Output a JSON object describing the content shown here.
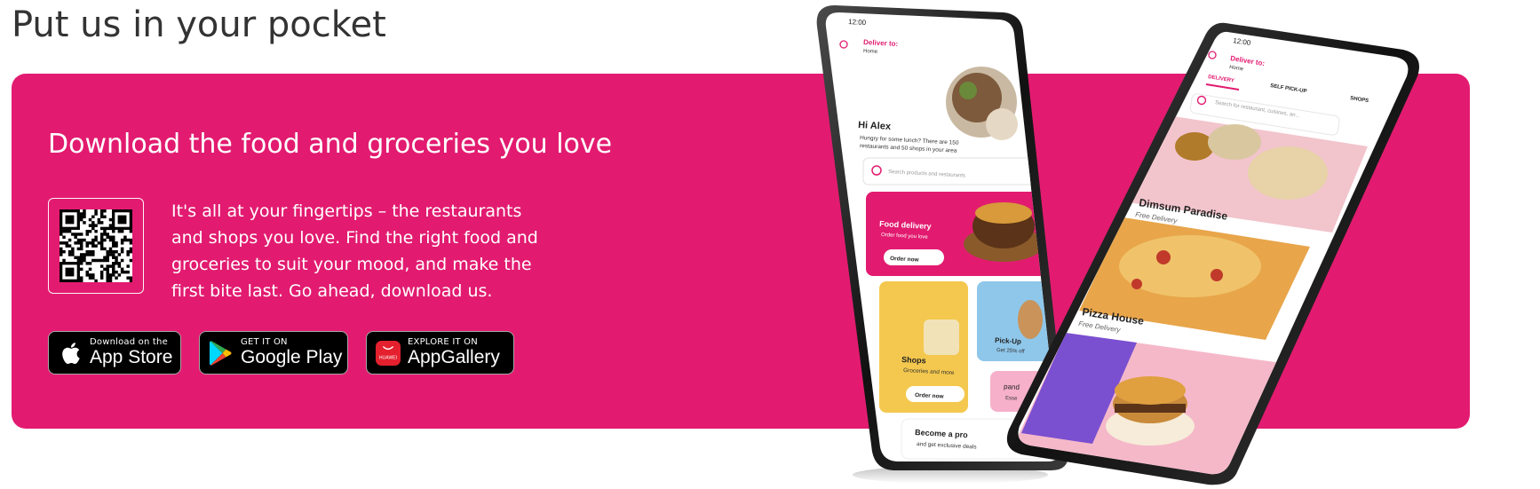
{
  "section": {
    "title": "Put us in your pocket"
  },
  "banner": {
    "heading": "Download the food and groceries you love",
    "body": "It's all at your fingertips – the restaurants and shops you love. Find the right food and groceries to suit your mood, and make the first bite last. Go ahead, download us.",
    "background_color": "#e21b70"
  },
  "qr": {
    "icon": "qr-code-icon"
  },
  "buttons": {
    "app_store": {
      "small": "Download on the",
      "big": "App Store",
      "icon": "apple-icon"
    },
    "google_play": {
      "small": "GET IT ON",
      "big": "Google Play",
      "icon": "google-play-icon"
    },
    "app_gallery": {
      "small": "EXPLORE IT ON",
      "big": "AppGallery",
      "icon": "huawei-icon",
      "icon_label": "HUAWEI"
    }
  },
  "phone_left": {
    "time": "12:00",
    "deliver_to": "Deliver to:",
    "deliver_address": "Home",
    "greeting": "Hi Alex",
    "greeting_sub_1": "Hungry for some lunch? There are 150",
    "greeting_sub_2": "restaurants and 50 shops in your area",
    "search_placeholder": "Search products and restaurants",
    "food_delivery_title": "Food delivery",
    "food_delivery_sub": "Order food you love",
    "order_now": "Order now",
    "shops_title": "Shops",
    "shops_sub": "Groceries and more",
    "shops_order_now": "Order now",
    "pickup_title": "Pick-Up",
    "pickup_sub": "Get 25% off",
    "pandamart_partial": "pand",
    "pandamart_sub_partial": "Esse",
    "pro_title": "Become a pro",
    "pro_sub": "and get exclusive deals"
  },
  "phone_right": {
    "time": "12:00",
    "deliver_to": "Deliver to:",
    "deliver_address": "Home",
    "tabs": [
      "DELIVERY",
      "SELF PICK-UP",
      "SHOPS"
    ],
    "search_placeholder": "Search for restaurant, cuisines, an...",
    "restaurant_1_name": "Dimsum Paradise",
    "restaurant_1_sub": "Free Delivery",
    "restaurant_2_name": "Pizza House",
    "restaurant_2_sub": "Free Delivery"
  }
}
